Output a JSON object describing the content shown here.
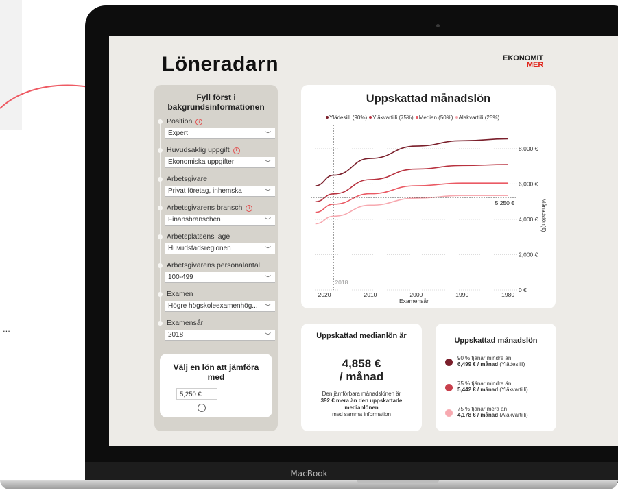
{
  "app": {
    "title": "Löneradarn",
    "logo_top": "EKONOMIT",
    "logo_bottom": "MER",
    "device_brand": "MacBook",
    "side_ellipsis": "..."
  },
  "form": {
    "heading": "Fyll först i bakgrundsinformationen",
    "fields": [
      {
        "label": "Position",
        "value": "Expert",
        "info": true
      },
      {
        "label": "Huvudsaklig uppgift",
        "value": "Ekonomiska uppgifter",
        "info": true
      },
      {
        "label": "Arbetsgivare",
        "value": "Privat företag, inhemska",
        "info": false
      },
      {
        "label": "Arbetsgivarens bransch",
        "value": "Finansbranschen",
        "info": true
      },
      {
        "label": "Arbetsplatsens läge",
        "value": "Huvudstadsregionen",
        "info": false
      },
      {
        "label": "Arbetsgivarens personalantal",
        "value": "100-499",
        "info": false
      },
      {
        "label": "Examen",
        "value": "Högre högskoleexamenhög...",
        "info": false
      },
      {
        "label": "Examensår",
        "value": "2018",
        "info": false
      }
    ],
    "compare": {
      "title": "Välj en lön att jämföra med",
      "input_value": "5,250 €",
      "slider_value": 5250
    }
  },
  "chart_data": {
    "type": "line",
    "title": "Uppskattad månadslön",
    "xlabel": "Examensår",
    "ylabel": "Månadslön(€)",
    "x_ticks": [
      2020,
      2010,
      2000,
      1990,
      1980
    ],
    "y_ticks": [
      "0 €",
      "2,000 €",
      "4,000 €",
      "6,000 €",
      "8,000 €"
    ],
    "ylim": [
      0,
      9200
    ],
    "x": [
      2022,
      2018,
      2010,
      2000,
      1990,
      1980
    ],
    "series": [
      {
        "name": "Ylädesiili (90%)",
        "color": "#7a1f2b",
        "values": [
          5900,
          6499,
          7450,
          8150,
          8450,
          8560
        ]
      },
      {
        "name": "Yläkvartiili (75%)",
        "color": "#b8323f",
        "values": [
          5000,
          5442,
          6250,
          6850,
          7050,
          7100
        ]
      },
      {
        "name": "Median (50%)",
        "color": "#ea5a64",
        "values": [
          4400,
          4858,
          5450,
          5900,
          6050,
          6050
        ]
      },
      {
        "name": "Alakvartiili (25%)",
        "color": "#f7a9b0",
        "values": [
          3750,
          4178,
          4800,
          5200,
          5350,
          5350
        ]
      }
    ],
    "reference_line": {
      "value": 5250,
      "label": "5,250 €"
    },
    "marker": {
      "x": 2018,
      "label": "2018"
    },
    "grid": true,
    "legend_position": "top"
  },
  "median": {
    "title": "Uppskattad medianlön är",
    "value": "4,858 €",
    "unit": "/ månad",
    "note_line1": "Den jämförbara månadslönen är",
    "note_bold": "392 € mera än den uppskattade medianlönen",
    "note_line3": "med samma information"
  },
  "percentiles": {
    "title": "Uppskattad månadslön",
    "items": [
      {
        "line1": "90 % tjänar mindre än",
        "bold": "6,499 € / månad",
        "suffix": " (Ylädesiili)",
        "color": "#7a1f2b"
      },
      {
        "line1": "75 % tjänar mindre än",
        "bold": "5,442 € / månad",
        "suffix": " (Yläkvartiili)",
        "color": "#c8404c"
      },
      {
        "line1": "75 % tjänar mera än",
        "bold": "4,178 € / månad",
        "suffix": " (Alakvartiili)",
        "color": "#f7a9b0"
      }
    ]
  }
}
